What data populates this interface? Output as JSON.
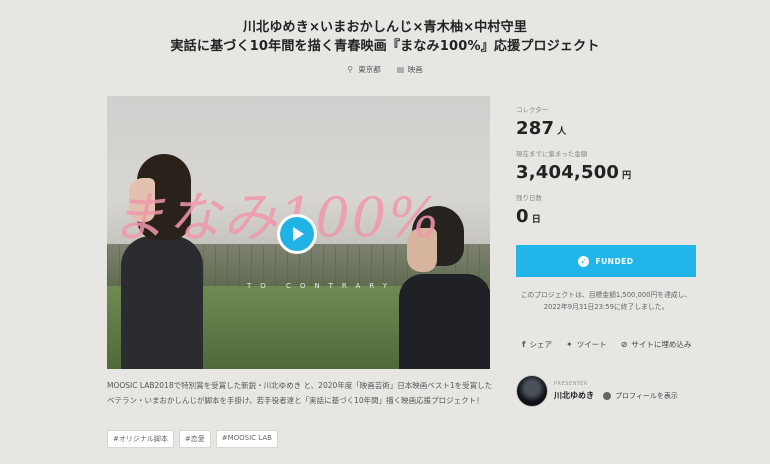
{
  "project": {
    "title_line1": "川北ゆめき×いまおかしんじ×青木柚×中村守里",
    "title_line2": "実話に基づく10年間を描く青春映画『まなみ100%』応援プロジェクト",
    "location": "東京都",
    "category": "映画"
  },
  "video": {
    "logo_text": "まなみ100%",
    "logo_sub": "TO CONTRARY"
  },
  "description": "MOOSIC LAB2018で特別賞を受賞した新鋭・川北ゆめき と、2020年度「映画芸術」日本映画ベスト1を受賞したベテラン・いまおかしんじが脚本を手掛け、若手役者達と「実話に基づく10年間」描く映画応援プロジェクト！",
  "tags": [
    "#オリジナル脚本",
    "#恋愛",
    "#MOOSIC LAB"
  ],
  "stats": {
    "collectors_label": "コレクター",
    "collectors_value": "287",
    "collectors_unit": "人",
    "amount_label": "現在までに集まった金額",
    "amount_value": "3,404,500",
    "amount_unit": "円",
    "days_label": "残り日数",
    "days_value": "0",
    "days_unit": "日"
  },
  "funded_label": "FUNDED",
  "note": "このプロジェクトは、目標金額1,500,000円を達成し、2022年9月31日23:59に終了しました。",
  "share": {
    "facebook": "シェア",
    "twitter": "ツイート",
    "embed": "サイトに埋め込み"
  },
  "presenter": {
    "label": "PRESENTER",
    "name": "川北ゆめき",
    "profile_link": "プロフィールを表示"
  },
  "colors": {
    "accent": "#21b5ea",
    "background": "#e8e6e3"
  }
}
